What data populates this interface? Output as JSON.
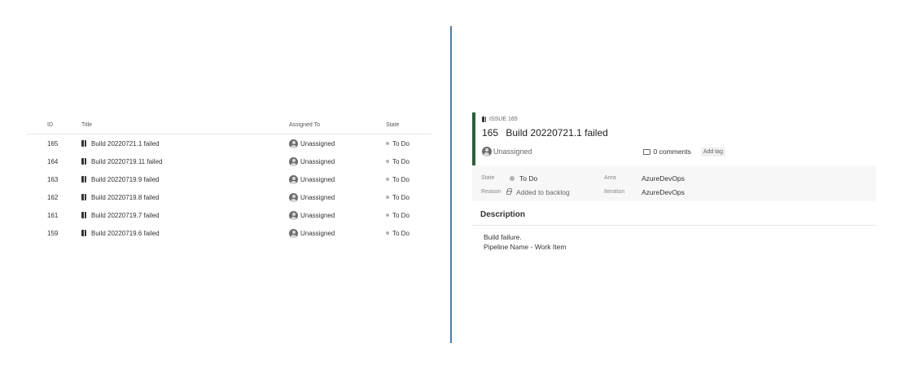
{
  "list": {
    "columns": {
      "id": "ID",
      "title": "Title",
      "assigned": "Assigned To",
      "state": "State"
    },
    "rows": [
      {
        "id": "165",
        "title": "Build 20220721.1 failed",
        "assigned": "Unassigned",
        "state": "To Do"
      },
      {
        "id": "164",
        "title": "Build 20220719.11 failed",
        "assigned": "Unassigned",
        "state": "To Do"
      },
      {
        "id": "163",
        "title": "Build 20220719.9 failed",
        "assigned": "Unassigned",
        "state": "To Do"
      },
      {
        "id": "162",
        "title": "Build 20220719.8 failed",
        "assigned": "Unassigned",
        "state": "To Do"
      },
      {
        "id": "161",
        "title": "Build 20220719.7 failed",
        "assigned": "Unassigned",
        "state": "To Do"
      },
      {
        "id": "159",
        "title": "Build 20220719.6 failed",
        "assigned": "Unassigned",
        "state": "To Do"
      }
    ]
  },
  "form": {
    "type_label": "ISSUE 165",
    "id": "165",
    "title": "Build 20220721.1 failed",
    "assigned": "Unassigned",
    "comments": "0 comments",
    "add_tag": "Add tag",
    "state_label": "State",
    "state_value": "To Do",
    "reason_label": "Reason",
    "reason_value": "Added to backlog",
    "area_label": "Area",
    "area_value": "AzureDevOps",
    "iteration_label": "Iteration",
    "iteration_value": "AzureDevOps",
    "description_heading": "Description",
    "description_line1": "Build failure.",
    "description_line2": "Pipeline Name - Work Item"
  },
  "colors": {
    "accent_bar": "#2d5e3f",
    "divider": "#4b7ea8",
    "state_dot": "#b2b2b2"
  },
  "icons": {
    "work_item": "bug-icon",
    "avatar": "unassigned-avatar-icon",
    "comment": "comment-icon",
    "reason": "lock-icon"
  }
}
